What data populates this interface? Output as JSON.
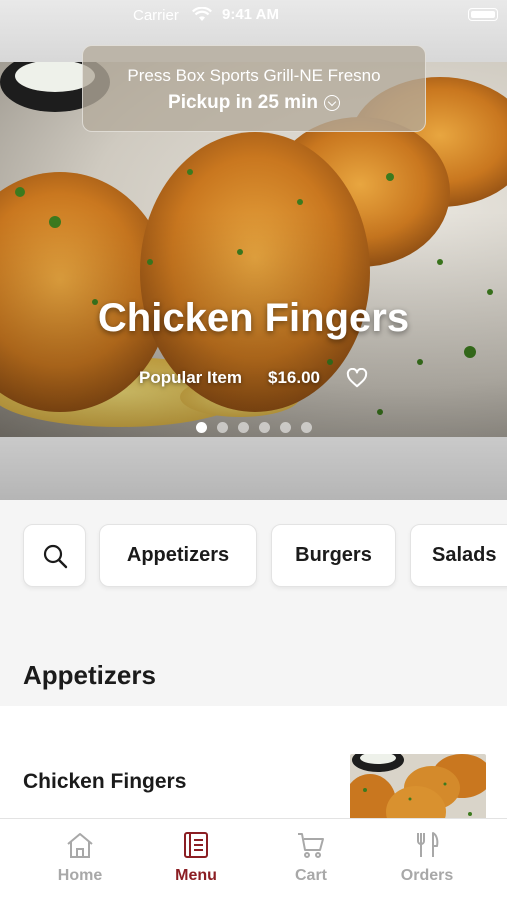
{
  "status_bar": {
    "carrier": "Carrier",
    "time": "9:41 AM"
  },
  "store": {
    "name": "Press Box Sports Grill-NE Fresno",
    "pickup": "Pickup in 25 min"
  },
  "hero": {
    "title": "Chicken Fingers",
    "badge": "Popular Item",
    "price": "$16.00",
    "slides_total": 6,
    "active_slide": 1
  },
  "categories": [
    "Appetizers",
    "Burgers",
    "Salads"
  ],
  "section": {
    "title": "Appetizers"
  },
  "items": [
    {
      "name": "Chicken Fingers"
    }
  ],
  "tabs": [
    {
      "label": "Home",
      "icon": "home-icon",
      "active": false
    },
    {
      "label": "Menu",
      "icon": "menu-icon",
      "active": true
    },
    {
      "label": "Cart",
      "icon": "cart-icon",
      "active": false
    },
    {
      "label": "Orders",
      "icon": "orders-icon",
      "active": false
    }
  ],
  "colors": {
    "accent": "#8b1e23",
    "inactive_tab": "#a8a8a8",
    "background": "#f5f5f5"
  }
}
